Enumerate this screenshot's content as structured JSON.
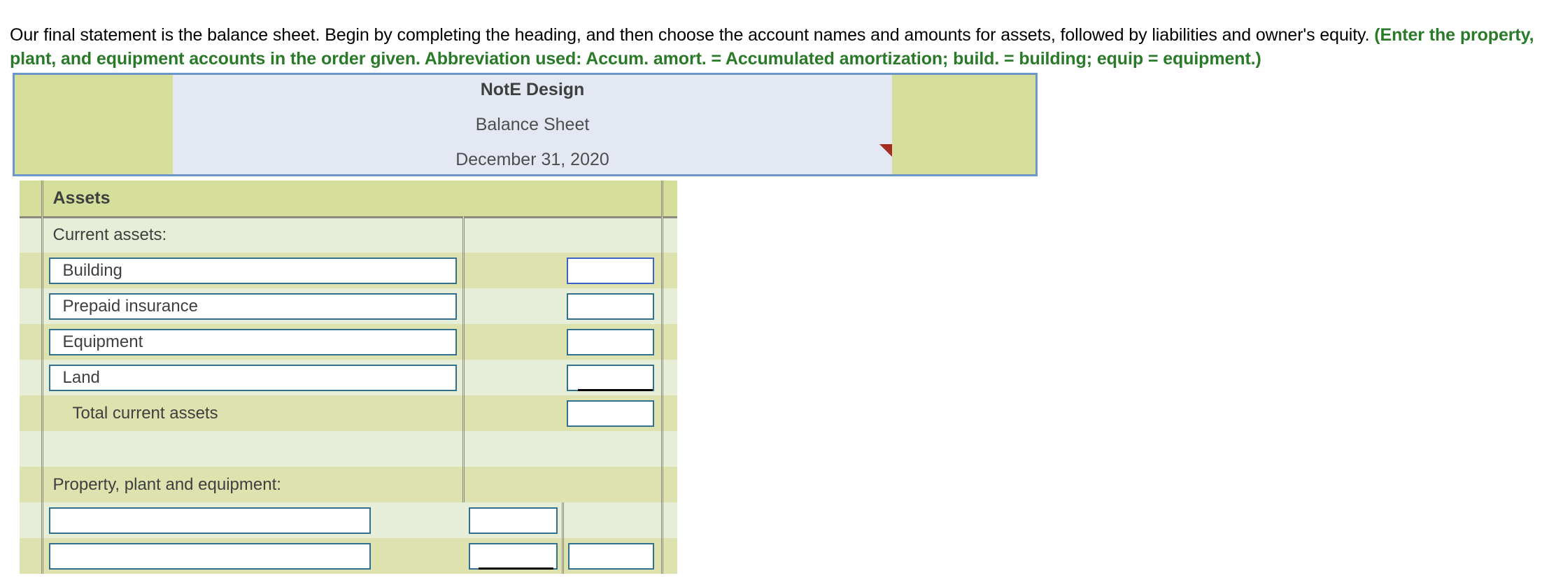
{
  "instructions": {
    "plain_1": "Our final statement is the balance sheet. Begin by completing the heading, and then choose the account names and amounts for assets, followed by liabilities and owner's equity. ",
    "hint": "(Enter the property, plant, and equipment accounts in the order given. Abbreviation used: Accum. amort. = Accumulated amortization; build. = building; equip = equipment.)"
  },
  "heading": {
    "company": "NotE Design",
    "statement": "Balance Sheet",
    "date": "December 31, 2020"
  },
  "colors": {
    "hint_green": "#2a7a2a",
    "heading_border_blue": "#6b97c9",
    "heading_fill_blue": "#e4e8f3",
    "heading_pad_green": "#d6de9b",
    "stripe_dark": "#dde2ae",
    "stripe_light": "#e7eed8",
    "field_border_teal": "#31708f",
    "field_border_focus_blue": "#3b62c4",
    "comment_flag_red": "#a32b22",
    "grid_gray": "#8a8a7d",
    "text_gray": "#3f3f3f"
  },
  "table": {
    "section_title": "Assets",
    "rows": [
      {
        "kind": "section-header",
        "label": "Assets"
      },
      {
        "kind": "text",
        "stripe": "light",
        "label": "Current assets:"
      },
      {
        "kind": "input-amount",
        "stripe": "dark",
        "label": "Building",
        "amount": "",
        "focused": true,
        "rule": false
      },
      {
        "kind": "input-amount",
        "stripe": "light",
        "label": "Prepaid insurance",
        "amount": "",
        "focused": false,
        "rule": false
      },
      {
        "kind": "input-amount",
        "stripe": "dark",
        "label": "Equipment",
        "amount": "",
        "focused": false,
        "rule": false
      },
      {
        "kind": "input-amount",
        "stripe": "light",
        "label": "Land",
        "amount": "",
        "focused": false,
        "rule": true
      },
      {
        "kind": "total",
        "stripe": "dark",
        "label": "Total current assets",
        "amount": ""
      },
      {
        "kind": "blank",
        "stripe": "light",
        "label": ""
      },
      {
        "kind": "text",
        "stripe": "dark",
        "label": "Property, plant and equipment:"
      },
      {
        "kind": "ppe",
        "stripe": "light",
        "label": "",
        "mid": "",
        "amount": null,
        "rule": false
      },
      {
        "kind": "ppe",
        "stripe": "dark",
        "label": "",
        "mid": "",
        "amount": "",
        "rule": true
      }
    ]
  }
}
